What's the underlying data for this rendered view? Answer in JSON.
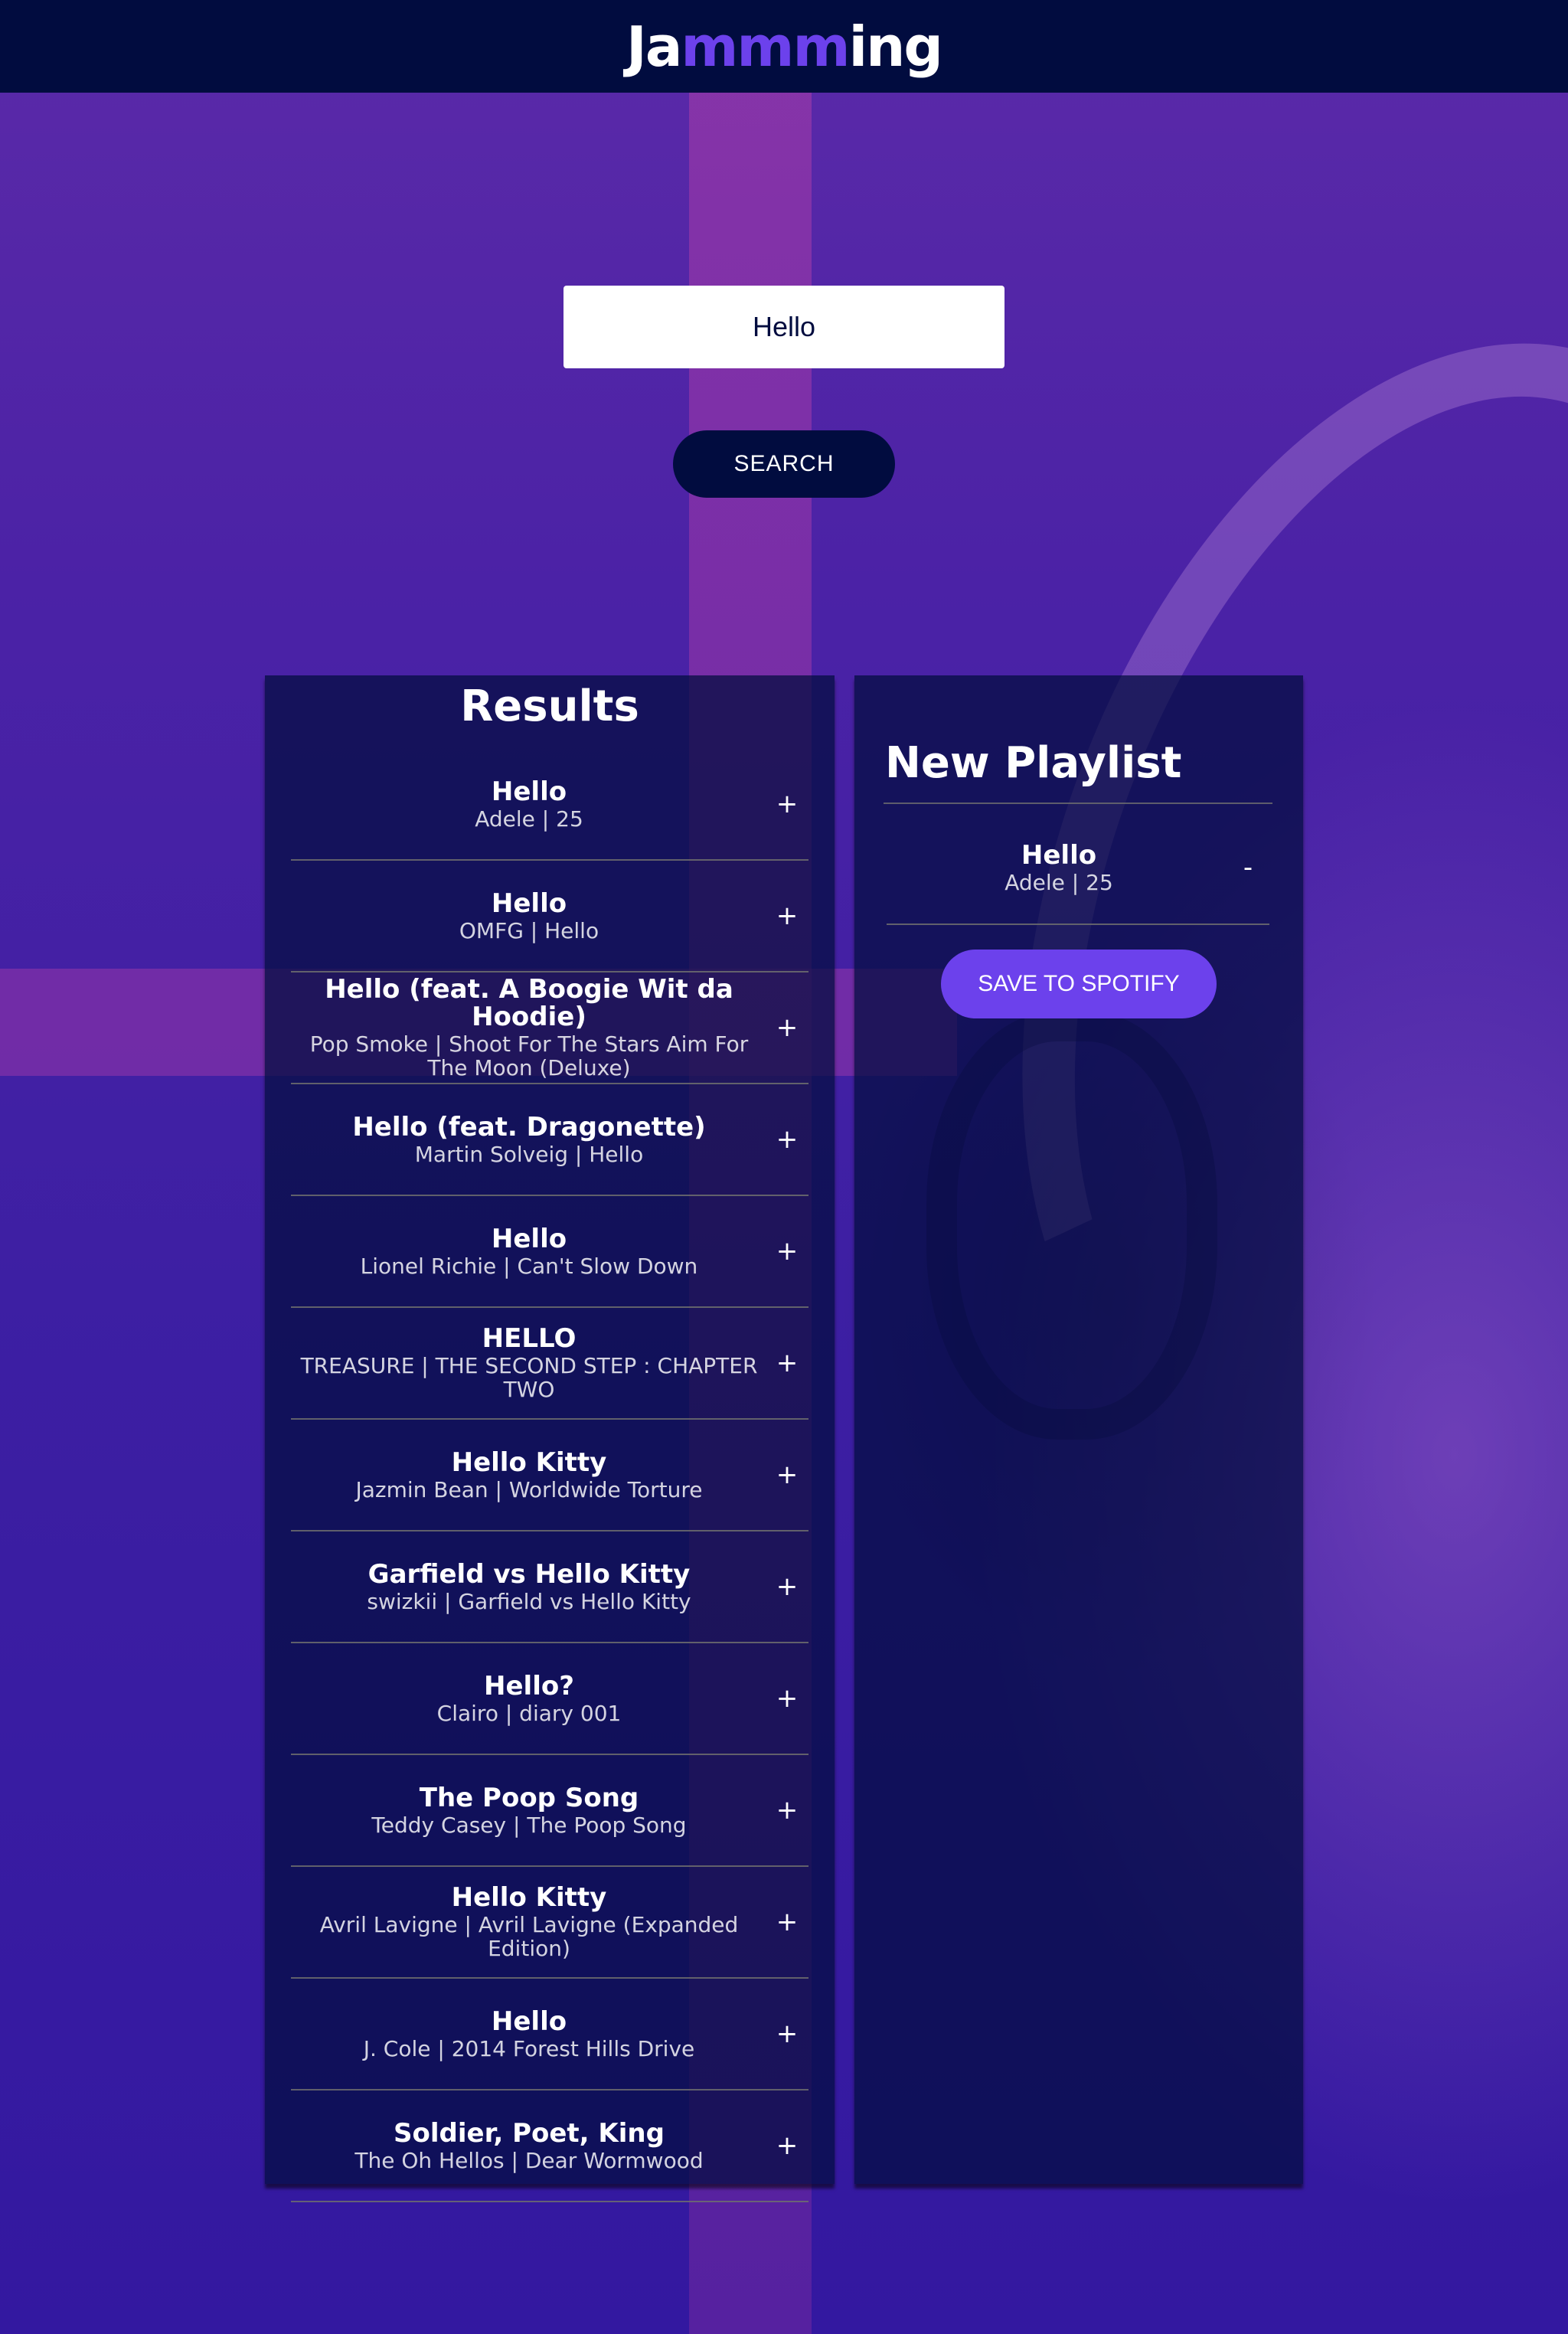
{
  "app": {
    "logo_prefix": "Ja",
    "logo_accent": "mmm",
    "logo_suffix": "ing"
  },
  "colors": {
    "header_bg": "#010c3f",
    "accent": "#6c41ec",
    "panel_bg": "#010c3f"
  },
  "search": {
    "value": "Hello",
    "placeholder": "Enter A Song, Album, or Artist",
    "button_label": "SEARCH"
  },
  "results": {
    "title": "Results",
    "action_icon": "plus",
    "tracks": [
      {
        "name": "Hello",
        "meta": "Adele | 25",
        "action": "+"
      },
      {
        "name": "Hello",
        "meta": "OMFG | Hello",
        "action": "+"
      },
      {
        "name": "Hello (feat. A Boogie Wit da Hoodie)",
        "meta": "Pop Smoke | Shoot For The Stars Aim For The Moon (Deluxe)",
        "action": "+"
      },
      {
        "name": "Hello (feat. Dragonette)",
        "meta": "Martin Solveig | Hello",
        "action": "+"
      },
      {
        "name": "Hello",
        "meta": "Lionel Richie | Can't Slow Down",
        "action": "+"
      },
      {
        "name": "HELLO",
        "meta": "TREASURE | THE SECOND STEP : CHAPTER TWO",
        "action": "+"
      },
      {
        "name": "Hello Kitty",
        "meta": "Jazmin Bean | Worldwide Torture",
        "action": "+"
      },
      {
        "name": "Garfield vs Hello Kitty",
        "meta": "swizkii | Garfield vs Hello Kitty",
        "action": "+"
      },
      {
        "name": "Hello?",
        "meta": "Clairo | diary 001",
        "action": "+"
      },
      {
        "name": "The Poop Song",
        "meta": "Teddy Casey | The Poop Song",
        "action": "+"
      },
      {
        "name": "Hello Kitty",
        "meta": "Avril Lavigne | Avril Lavigne (Expanded Edition)",
        "action": "+"
      },
      {
        "name": "Hello",
        "meta": "J. Cole | 2014 Forest Hills Drive",
        "action": "+"
      },
      {
        "name": "Soldier, Poet, King",
        "meta": "The Oh Hellos | Dear Wormwood",
        "action": "+"
      }
    ]
  },
  "playlist": {
    "title": "New Playlist",
    "action_icon": "minus",
    "tracks": [
      {
        "name": "Hello",
        "meta": "Adele | 25",
        "action": "-"
      }
    ],
    "save_label": "SAVE TO SPOTIFY"
  }
}
